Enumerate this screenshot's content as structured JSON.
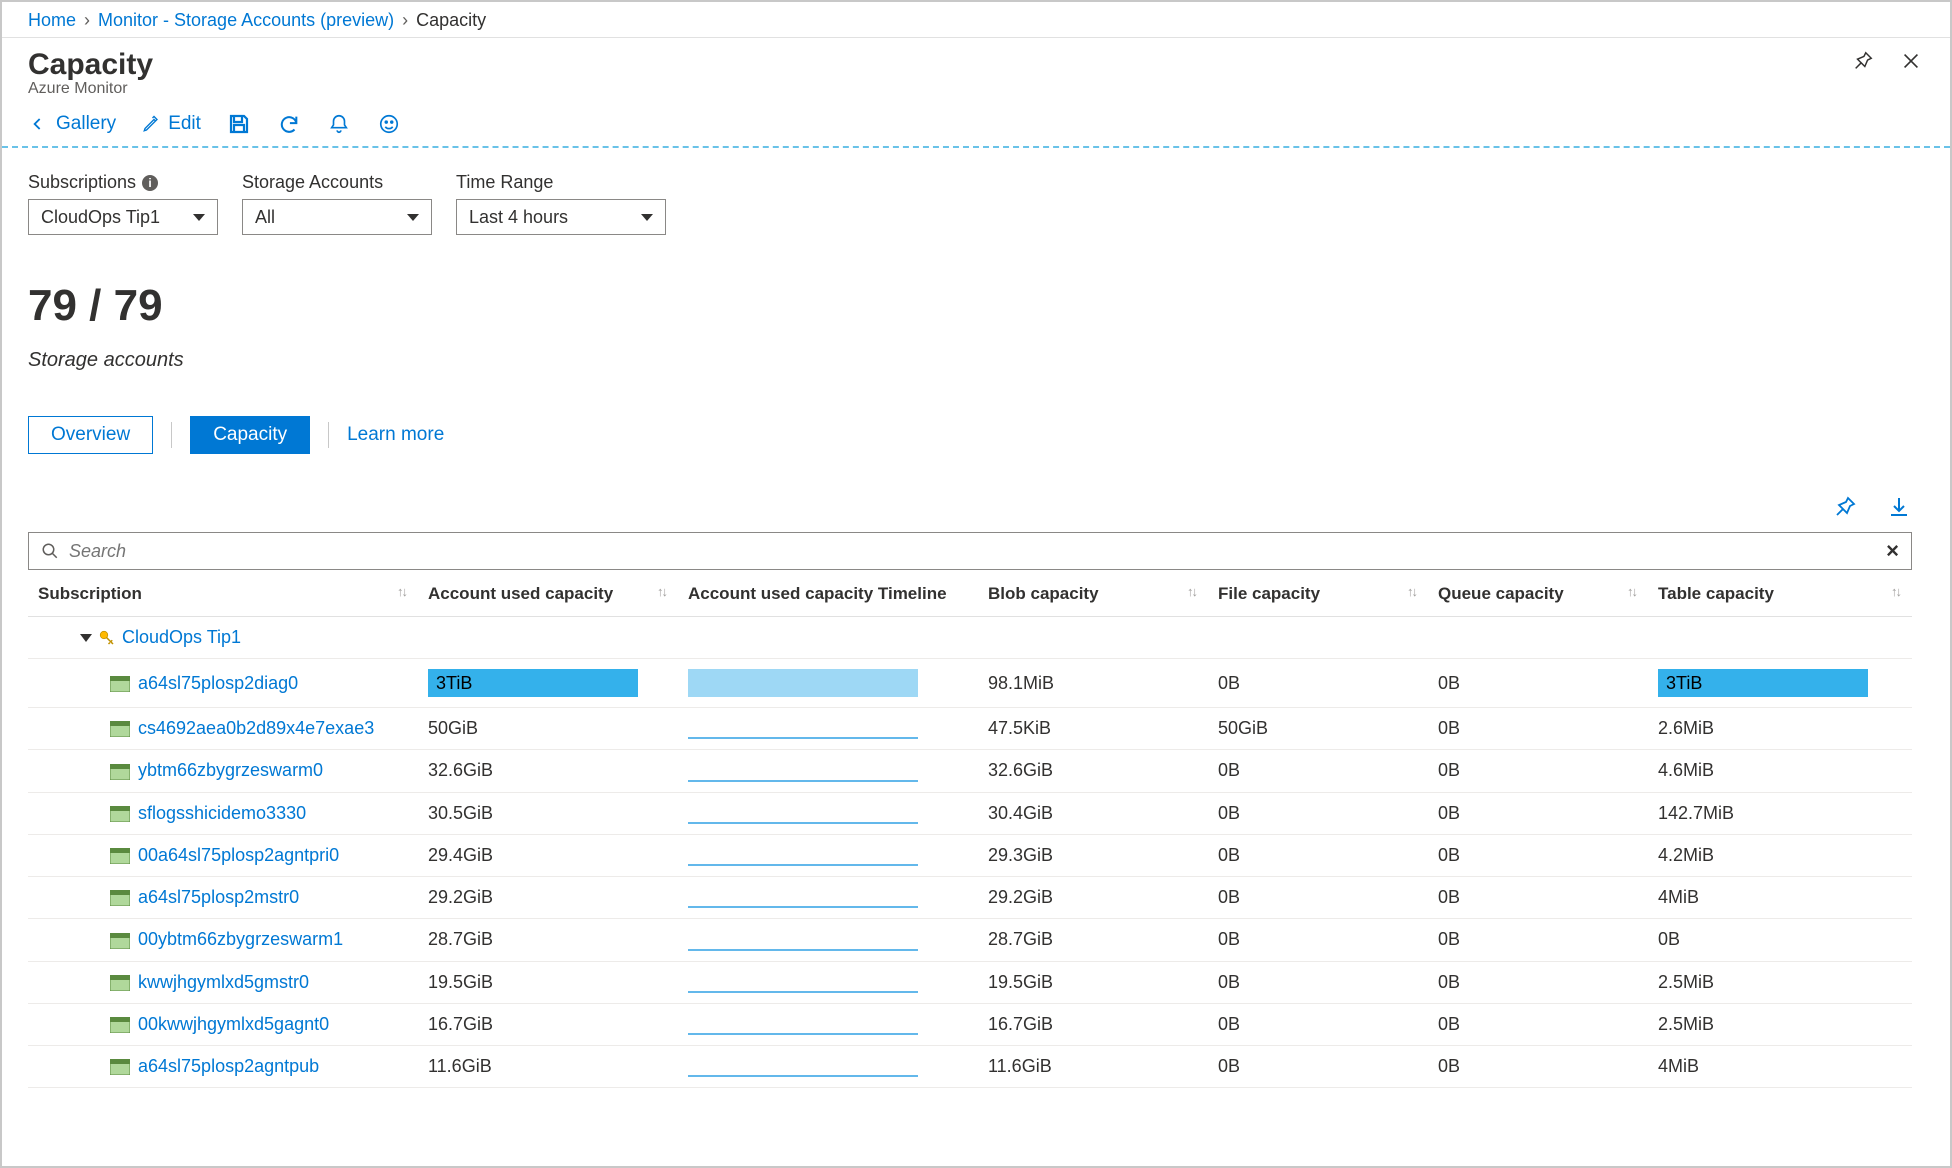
{
  "breadcrumb": {
    "home": "Home",
    "monitor": "Monitor - Storage Accounts (preview)",
    "current": "Capacity"
  },
  "header": {
    "title": "Capacity",
    "subtitle": "Azure Monitor"
  },
  "toolbar": {
    "gallery": "Gallery",
    "edit": "Edit"
  },
  "filters": {
    "subs_label": "Subscriptions",
    "subs_value": "CloudOps Tip1",
    "sa_label": "Storage Accounts",
    "sa_value": "All",
    "time_label": "Time Range",
    "time_value": "Last 4 hours"
  },
  "summary": {
    "count": "79 / 79",
    "label": "Storage accounts"
  },
  "tabs": {
    "overview": "Overview",
    "capacity": "Capacity",
    "learn": "Learn more"
  },
  "search": {
    "placeholder": "Search"
  },
  "columns": {
    "c0": "Subscription",
    "c1": "Account used capacity",
    "c2": "Account used capacity Timeline",
    "c3": "Blob capacity",
    "c4": "File capacity",
    "c5": "Queue capacity",
    "c6": "Table capacity"
  },
  "group": {
    "name": "CloudOps Tip1"
  },
  "rows": [
    {
      "name": "a64sl75plosp2diag0",
      "used": "3TiB",
      "blob": "98.1MiB",
      "file": "0B",
      "queue": "0B",
      "table": "3TiB",
      "barUsed": 210,
      "barTable": 210,
      "highlight": true,
      "spark": "light"
    },
    {
      "name": "cs4692aea0b2d89x4e7exae3",
      "used": "50GiB",
      "blob": "47.5KiB",
      "file": "50GiB",
      "queue": "0B",
      "table": "2.6MiB",
      "barUsed": 0,
      "barTable": 0
    },
    {
      "name": "ybtm66zbygrzeswarm0",
      "used": "32.6GiB",
      "blob": "32.6GiB",
      "file": "0B",
      "queue": "0B",
      "table": "4.6MiB",
      "barUsed": 0,
      "barTable": 0
    },
    {
      "name": "sflogsshicidemo3330",
      "used": "30.5GiB",
      "blob": "30.4GiB",
      "file": "0B",
      "queue": "0B",
      "table": "142.7MiB",
      "barUsed": 0,
      "barTable": 0
    },
    {
      "name": "00a64sl75plosp2agntpri0",
      "used": "29.4GiB",
      "blob": "29.3GiB",
      "file": "0B",
      "queue": "0B",
      "table": "4.2MiB",
      "barUsed": 0,
      "barTable": 0
    },
    {
      "name": "a64sl75plosp2mstr0",
      "used": "29.2GiB",
      "blob": "29.2GiB",
      "file": "0B",
      "queue": "0B",
      "table": "4MiB",
      "barUsed": 0,
      "barTable": 0
    },
    {
      "name": "00ybtm66zbygrzeswarm1",
      "used": "28.7GiB",
      "blob": "28.7GiB",
      "file": "0B",
      "queue": "0B",
      "table": "0B",
      "barUsed": 0,
      "barTable": 0
    },
    {
      "name": "kwwjhgymlxd5gmstr0",
      "used": "19.5GiB",
      "blob": "19.5GiB",
      "file": "0B",
      "queue": "0B",
      "table": "2.5MiB",
      "barUsed": 0,
      "barTable": 0
    },
    {
      "name": "00kwwjhgymlxd5gagnt0",
      "used": "16.7GiB",
      "blob": "16.7GiB",
      "file": "0B",
      "queue": "0B",
      "table": "2.5MiB",
      "barUsed": 0,
      "barTable": 0
    },
    {
      "name": "a64sl75plosp2agntpub",
      "used": "11.6GiB",
      "blob": "11.6GiB",
      "file": "0B",
      "queue": "0B",
      "table": "4MiB",
      "barUsed": 0,
      "barTable": 0
    }
  ]
}
